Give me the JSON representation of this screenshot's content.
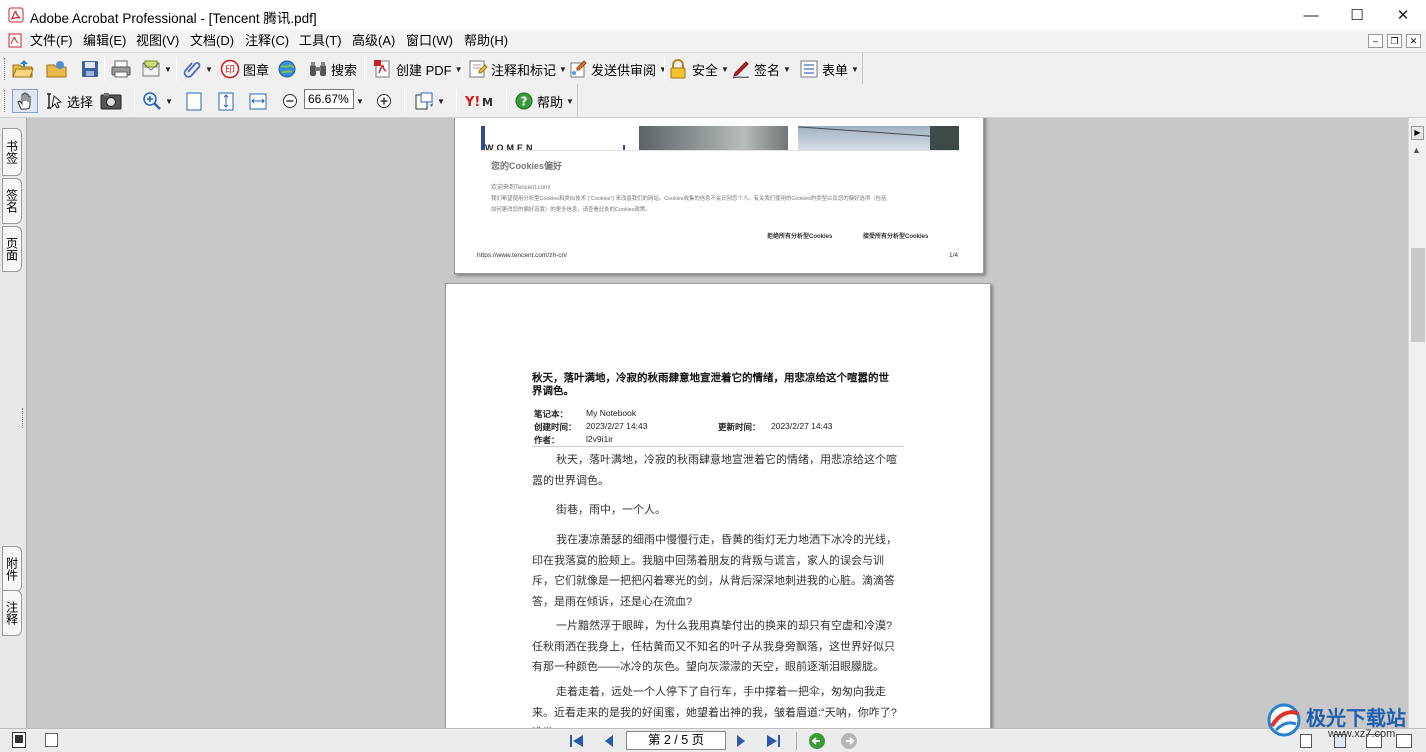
{
  "window": {
    "title": "Adobe Acrobat Professional - [Tencent 腾讯.pdf]",
    "minimize": "—",
    "maximize": "☐",
    "close": "✕"
  },
  "menu": [
    "文件(F)",
    "编辑(E)",
    "视图(V)",
    "文档(D)",
    "注释(C)",
    "工具(T)",
    "高级(A)",
    "窗口(W)",
    "帮助(H)"
  ],
  "toolbar1": {
    "stamp": "图章",
    "search": "搜索",
    "create_pdf": "创建 PDF",
    "comment": "注释和标记",
    "review": "发送供审阅",
    "secure": "安全",
    "sign": "签名",
    "forms": "表单"
  },
  "toolbar2": {
    "select": "选择",
    "zoom": "66.67%",
    "help": "帮助"
  },
  "left_tabs": [
    "书签",
    "签名",
    "页面",
    "附件",
    "注释"
  ],
  "page1": {
    "women": "WOMEN",
    "cookie_title": "您的Cookies偏好",
    "cookie_line1": "欢迎来到Tencent.com!",
    "cookie_line2": "我们希望使用分析型Cookies和类似技术 (“Cookies”) 来改善我们的网站。Cookies收集的信息不会识别您个人。有关我们使用的Cookies的类型以及您的偏好选项（包括",
    "cookie_line3": "如何更改您的偏好设置）的更多信息，请查看此处的Cookies政策。",
    "reject": "拒绝所有分析型Cookies",
    "accept": "接受所有分析型Cookies",
    "url": "https://www.tencent.com/zh-cn/",
    "pagenum": "1/4"
  },
  "page2": {
    "heading": "秋天，落叶满地，冷寂的秋雨肆意地宣泄着它的情绪，用悲凉给这个喧嚣的世界调色。",
    "notebook_label": "笔记本：",
    "notebook_value": "My Notebook",
    "created_label": "创建时间：",
    "created_value": "2023/2/27 14:43",
    "updated_label": "更新时间：",
    "updated_value": "2023/2/27 14:43",
    "author_label": "作者：",
    "author_value": "l2v9i1ir",
    "paragraphs": [
      "秋天，落叶满地，冷寂的秋雨肆意地宣泄着它的情绪，用悲凉给这个喧嚣的世界调色。",
      "街巷，雨中，一个人。",
      "我在凄凉萧瑟的细雨中慢慢行走，昏黄的街灯无力地洒下冰冷的光线，印在我落寞的脸颊上。我脑中回荡着朋友的背叛与谎言，家人的误会与训斥，它们就像是一把把闪着寒光的剑，从背后深深地刺进我的心脏。滴滴答答，是雨在倾诉，还是心在流血?",
      "一片黯然浮于眼眸，为什么我用真挚付出的换来的却只有空虚和冷漠?任秋雨洒在我身上，任枯黄而又不知名的叶子从我身旁飘落，这世界好似只有那一种颜色——冰冷的灰色。望向灰濛濛的天空，眼前逐渐泪眼朦胧。",
      "走着走着，远处一个人停下了自行车，手中撑着一把伞，匆匆向我走来。近看走来的是我的好闺蜜，她望着出神的我，皱着眉道:“天呐，你咋了?谁欺"
    ]
  },
  "status": {
    "page_label": "第 2 / 5 页"
  },
  "watermark": {
    "text": "极光下载站",
    "url": "www.xz7.com"
  }
}
